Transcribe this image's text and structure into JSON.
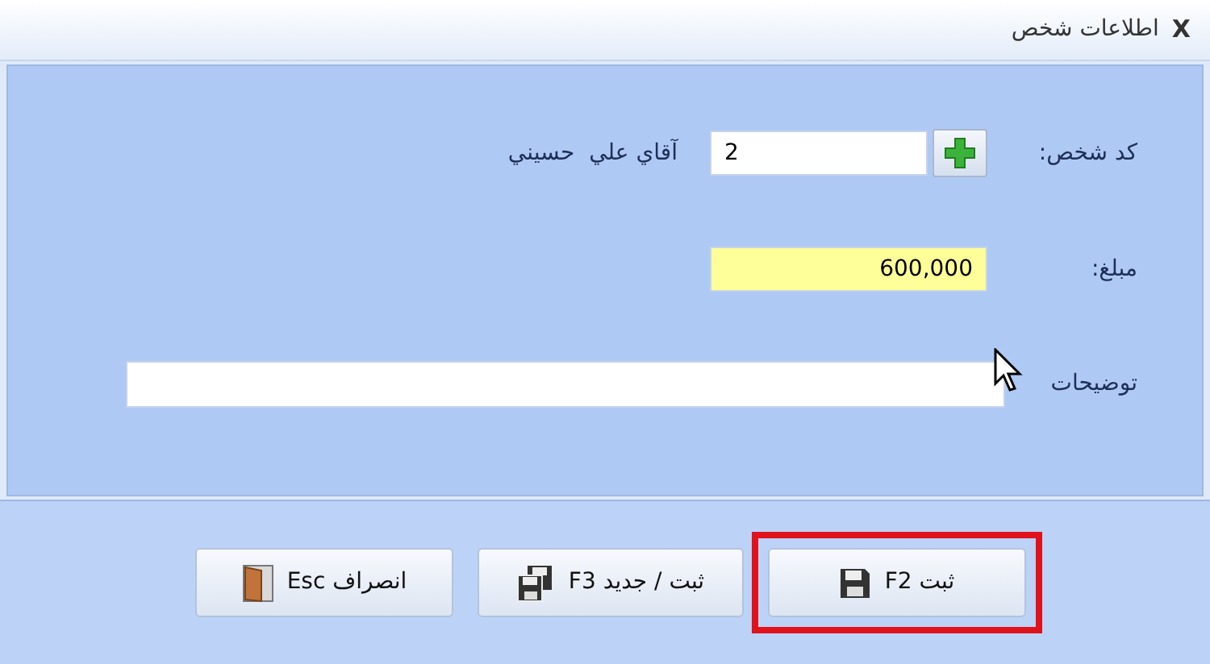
{
  "window": {
    "title": "اطلاعات شخص",
    "close": "X"
  },
  "fields": [
    {
      "kind": "code",
      "label": "کد شخص:",
      "value": "2",
      "name_text": "آقاي علي  حسيني"
    },
    {
      "kind": "amount",
      "label": "مبلغ:",
      "value": "600,000"
    },
    {
      "kind": "notes",
      "label": "توضیحات"
    }
  ],
  "buttons": [
    {
      "kind": "save",
      "label": "ثبت F2",
      "highlighted": true
    },
    {
      "kind": "save_new",
      "label": "ثبت / جدید F3",
      "highlighted": false
    },
    {
      "kind": "cancel",
      "label": "انصراف Esc",
      "highlighted": false
    }
  ]
}
